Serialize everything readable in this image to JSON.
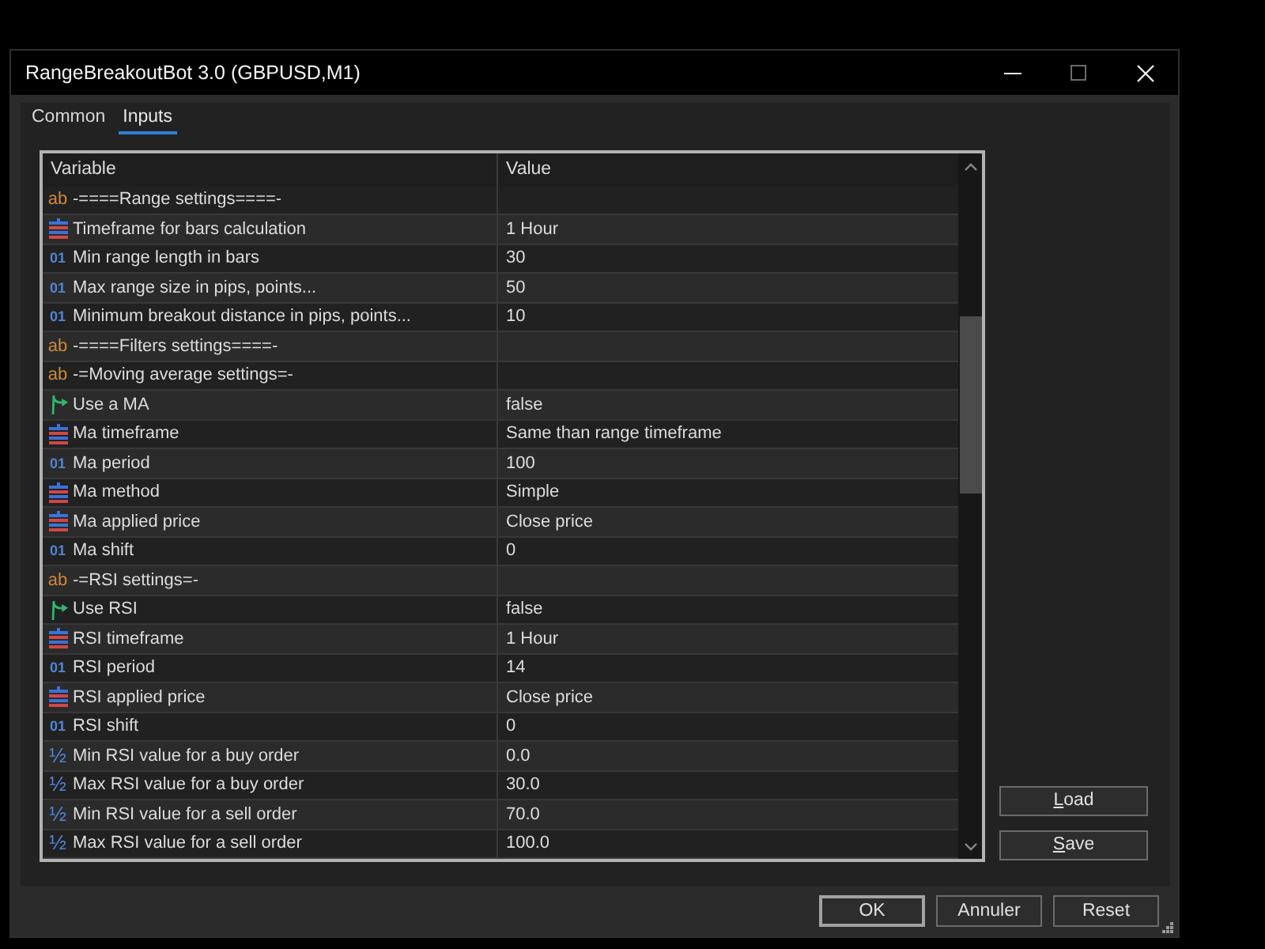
{
  "window": {
    "title": "RangeBreakoutBot 3.0 (GBPUSD,M1)"
  },
  "tabs": [
    {
      "label": "Common",
      "selected": false
    },
    {
      "label": "Inputs",
      "selected": true
    }
  ],
  "table": {
    "columns": [
      "Variable",
      "Value"
    ],
    "rows": [
      {
        "kind": "string",
        "glyph": "ab",
        "variable": "-====Range settings====-"
      },
      {
        "kind": "enum",
        "variable": "Timeframe for bars calculation",
        "value": "1 Hour"
      },
      {
        "kind": "int",
        "glyph": "01",
        "variable": "Min range length in bars",
        "value": "30"
      },
      {
        "kind": "int",
        "glyph": "01",
        "variable": "Max range size in pips, points...",
        "value": "50"
      },
      {
        "kind": "int",
        "glyph": "01",
        "variable": "Minimum breakout distance in pips, points...",
        "value": "10"
      },
      {
        "kind": "string",
        "glyph": "ab",
        "variable": "-====Filters settings====-"
      },
      {
        "kind": "string",
        "glyph": "ab",
        "variable": "-=Moving average settings=-"
      },
      {
        "kind": "bool",
        "variable": "Use a MA",
        "value": "false"
      },
      {
        "kind": "enum",
        "variable": "Ma timeframe",
        "value": "Same than range timeframe"
      },
      {
        "kind": "int",
        "glyph": "01",
        "variable": "Ma period",
        "value": "100"
      },
      {
        "kind": "enum",
        "variable": "Ma method",
        "value": "Simple"
      },
      {
        "kind": "enum",
        "variable": "Ma applied price",
        "value": "Close price"
      },
      {
        "kind": "int",
        "glyph": "01",
        "variable": "Ma shift",
        "value": "0"
      },
      {
        "kind": "string",
        "glyph": "ab",
        "variable": "-=RSI settings=-"
      },
      {
        "kind": "bool",
        "variable": "Use RSI",
        "value": "false"
      },
      {
        "kind": "enum",
        "variable": "RSI timeframe",
        "value": "1 Hour"
      },
      {
        "kind": "int",
        "glyph": "01",
        "variable": "RSI period",
        "value": "14"
      },
      {
        "kind": "enum",
        "variable": "RSI applied price",
        "value": "Close price"
      },
      {
        "kind": "int",
        "glyph": "01",
        "variable": "RSI shift",
        "value": "0"
      },
      {
        "kind": "double",
        "glyph": "½",
        "variable": "Min RSI value for a buy order",
        "value": "0.0"
      },
      {
        "kind": "double",
        "glyph": "½",
        "variable": "Max RSI value for a buy order",
        "value": "30.0"
      },
      {
        "kind": "double",
        "glyph": "½",
        "variable": "Min RSI value for a sell order",
        "value": "70.0"
      },
      {
        "kind": "double",
        "glyph": "½",
        "variable": "Max RSI value for a sell order",
        "value": "100.0"
      }
    ]
  },
  "side_buttons": [
    {
      "label": "Load"
    },
    {
      "label": "Save"
    }
  ],
  "buttons": [
    {
      "label": "OK",
      "default": true
    },
    {
      "label": "Annuler",
      "default": false
    },
    {
      "label": "Reset",
      "default": false
    }
  ]
}
